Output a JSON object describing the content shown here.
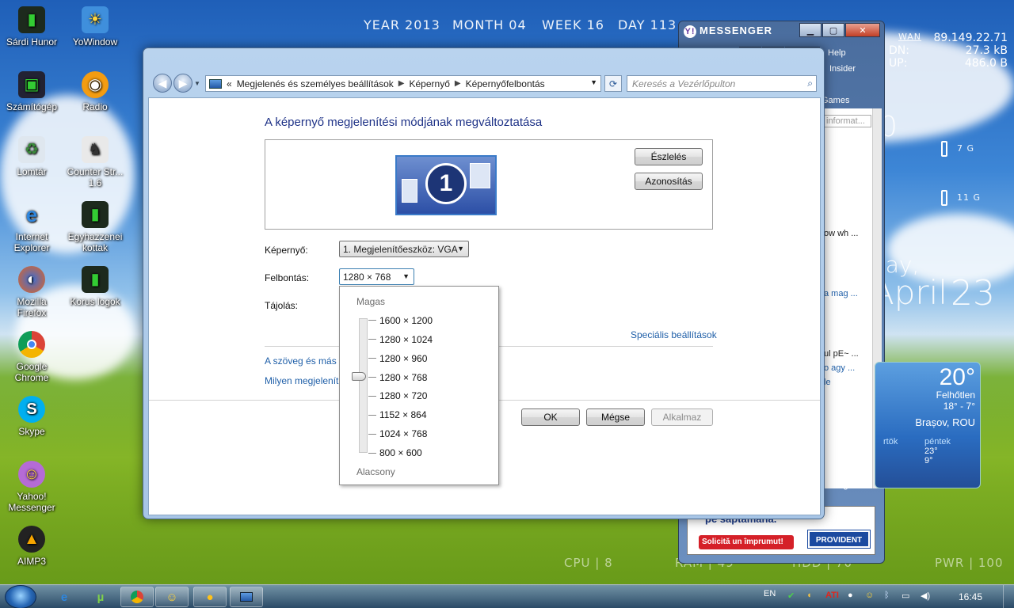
{
  "desktop": {
    "icons": [
      {
        "label": "Sárdi Hunor",
        "icon": "folder-icon"
      },
      {
        "label": "YoWindow",
        "icon": "sun-icon"
      },
      {
        "label": "Számítógép",
        "icon": "computer-icon"
      },
      {
        "label": "Radio",
        "icon": "radio-icon"
      },
      {
        "label": "Lomtár",
        "icon": "recycle-bin-icon"
      },
      {
        "label": "Counter Str... 1.6",
        "icon": "counter-strike-icon"
      },
      {
        "label": "Internet Explorer",
        "icon": "ie-icon"
      },
      {
        "label": "Egyhazzenei kottak",
        "icon": "folder-icon"
      },
      {
        "label": "Mozilla Firefox",
        "icon": "firefox-icon"
      },
      {
        "label": "Korus logok",
        "icon": "folder-icon"
      },
      {
        "label": "Google Chrome",
        "icon": "chrome-icon"
      },
      {
        "label": "Skype",
        "icon": "skype-icon"
      },
      {
        "label": "Yahoo! Messenger",
        "icon": "yahoo-messenger-icon"
      },
      {
        "label": "AIMP3",
        "icon": "aimp-icon"
      }
    ],
    "rainmeter_top": {
      "year": "YEAR 2013",
      "month": "MONTH 04",
      "week": "WEEK 16",
      "day": "DAY 113"
    },
    "rainmeter_bottom": {
      "cpu": "CPU  |  8",
      "ram": "RAM  |  49",
      "hdd": "HDD  |  70",
      "pwr": "PWR  |  100"
    },
    "network": {
      "wan": "WAN",
      "ip": "89.149.22.71",
      "dn_label": "DN:",
      "dn": "27.3 kB",
      "up_label": "UP:",
      "up": "486.0 B"
    },
    "storage": {
      "g1": "7 G",
      "g2": "11 G"
    },
    "big_date": {
      "day": "day,",
      "month": "April",
      "num": "23",
      "zero": "0"
    }
  },
  "messenger": {
    "title": "MESSENGER",
    "menu_help": "Help",
    "insider": "Insider",
    "games": "Games",
    "updates": "dates",
    "info_field": "informat...",
    "items": [
      "ow wh ...",
      "a mag ...",
      "ul pE~ ...",
      "o agy ...",
      "le"
    ],
    "plugins": "ld Plug-ins",
    "ad_line1": "pe săptămână.",
    "ad_cta": "Solicită un împrumut!",
    "ad_brand": "PROVIDENT"
  },
  "weather": {
    "temp": "20°",
    "condition": "Felhőtlen",
    "hi_lo": "18°  -  7°",
    "location": "Brașov, ROU",
    "d1_name": "rtök",
    "d2_name": "péntek",
    "d2_hi": "23°",
    "d2_lo": "9°"
  },
  "window": {
    "breadcrumb": [
      "Megjelenés és személyes beállítások",
      "Képernyő",
      "Képernyőfelbontás"
    ],
    "breadcrumb_prefix": "«",
    "search_placeholder": "Keresés a Vezérlőpulton",
    "heading": "A képernyő megjelenítési módjának megváltoztatása",
    "monitor_number": "1",
    "detect_button": "Észlelés",
    "identify_button": "Azonosítás",
    "display_label": "Képernyő:",
    "display_value": "1. Megjelenítőeszköz: VGA",
    "resolution_label": "Felbontás:",
    "resolution_value": "1280 × 768",
    "orientation_label": "Tájolás:",
    "advanced_link": "Speciális beállítások",
    "link_text_size": "A szöveg és más e",
    "link_which": "Milyen megjelenít",
    "ok": "OK",
    "cancel": "Mégse",
    "apply": "Alkalmaz"
  },
  "resolution_popup": {
    "high": "Magas",
    "low": "Alacsony",
    "options": [
      "1600 × 1200",
      "1280 × 1024",
      "1280 × 960",
      "1280 × 768",
      "1280 × 720",
      "1152 × 864",
      "1024 × 768",
      "800 × 600"
    ],
    "selected_index": 3
  },
  "taskbar": {
    "lang": "EN",
    "time": "16:45"
  }
}
